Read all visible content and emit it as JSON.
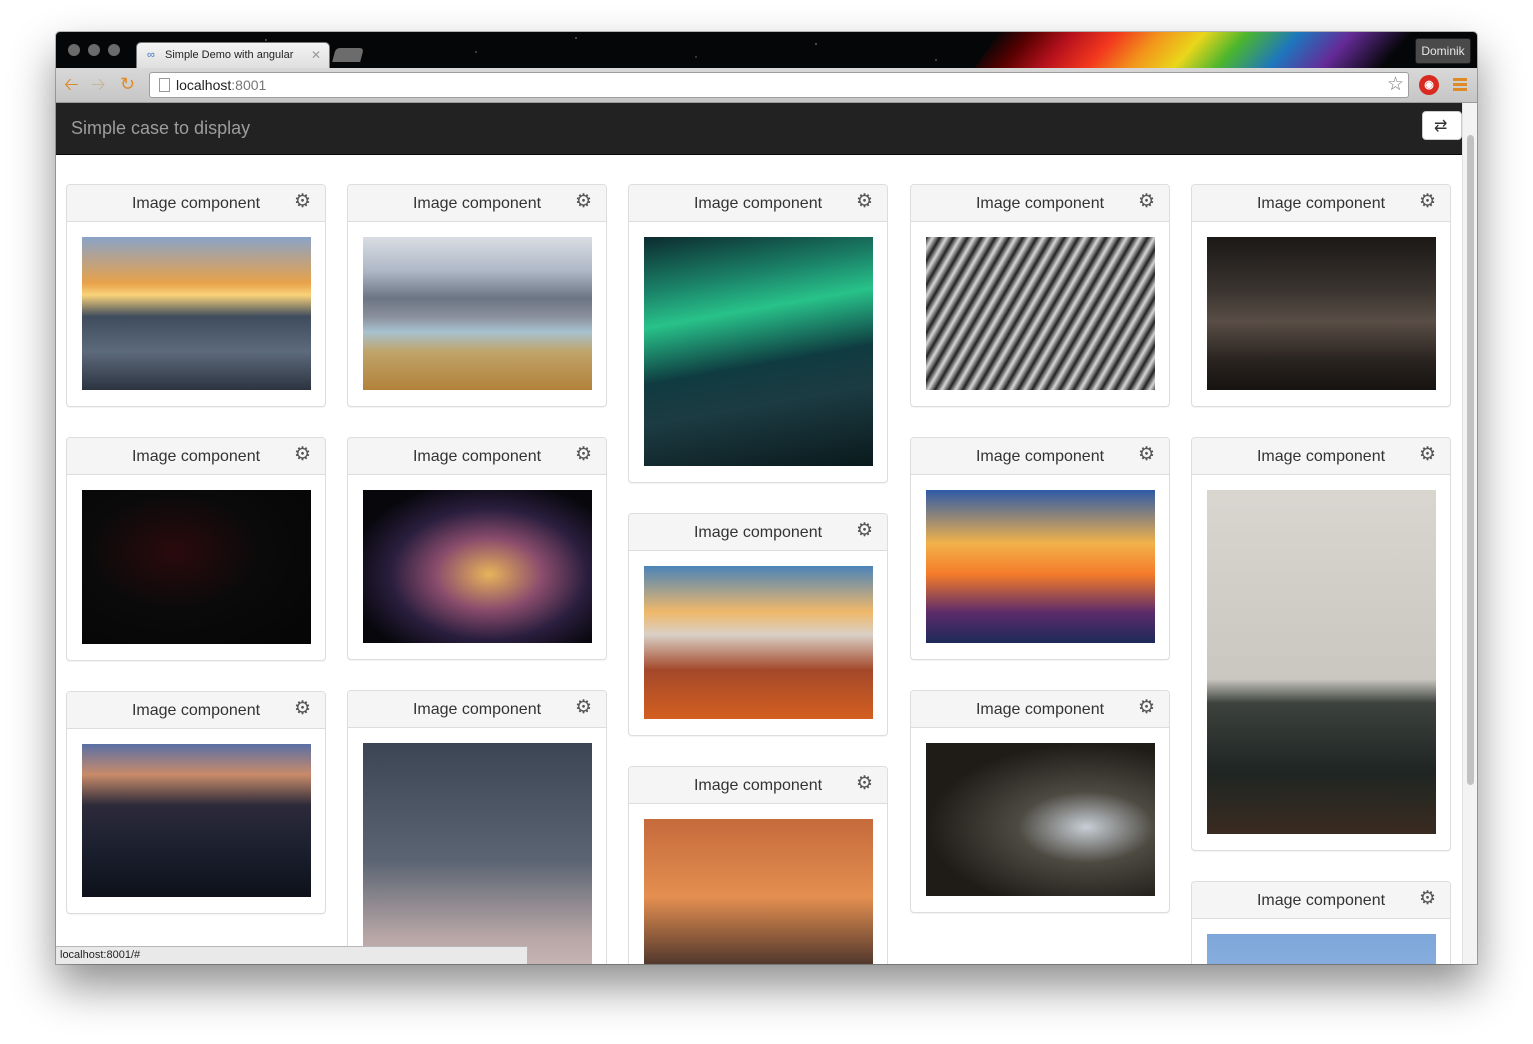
{
  "browser": {
    "tab_title": "Simple Demo with angular",
    "profile_name": "Dominik",
    "url_host": "localhost",
    "url_port": ":8001",
    "status_url": "localhost:8001/#"
  },
  "app": {
    "title": "Simple case to display",
    "accent": "#222222"
  },
  "panels": [
    {
      "title": "Image component",
      "image": "sunset-skatepark"
    },
    {
      "title": "Image component",
      "image": "mountain-lake"
    },
    {
      "title": "Image component",
      "image": "northern-lights"
    },
    {
      "title": "Image component",
      "image": "abstract-architecture"
    },
    {
      "title": "Image component",
      "image": "vintage-car"
    },
    {
      "title": "Image component",
      "image": "red-ribbon-antler"
    },
    {
      "title": "Image component",
      "image": "milky-way"
    },
    {
      "title": "Image component",
      "image": "mountain-sunset-clouds"
    },
    {
      "title": "Image component",
      "image": "pier-sunset"
    },
    {
      "title": "Image component",
      "image": "cafe-interior"
    },
    {
      "title": "Image component",
      "image": "city-night-skyline"
    },
    {
      "title": "Image component",
      "image": "skyscraper-clouds"
    },
    {
      "title": "Image component",
      "image": "mountain-silhouette"
    },
    {
      "title": "Image component",
      "image": "woman-reading"
    },
    {
      "title": "Image component",
      "image": "blue-sky"
    }
  ]
}
